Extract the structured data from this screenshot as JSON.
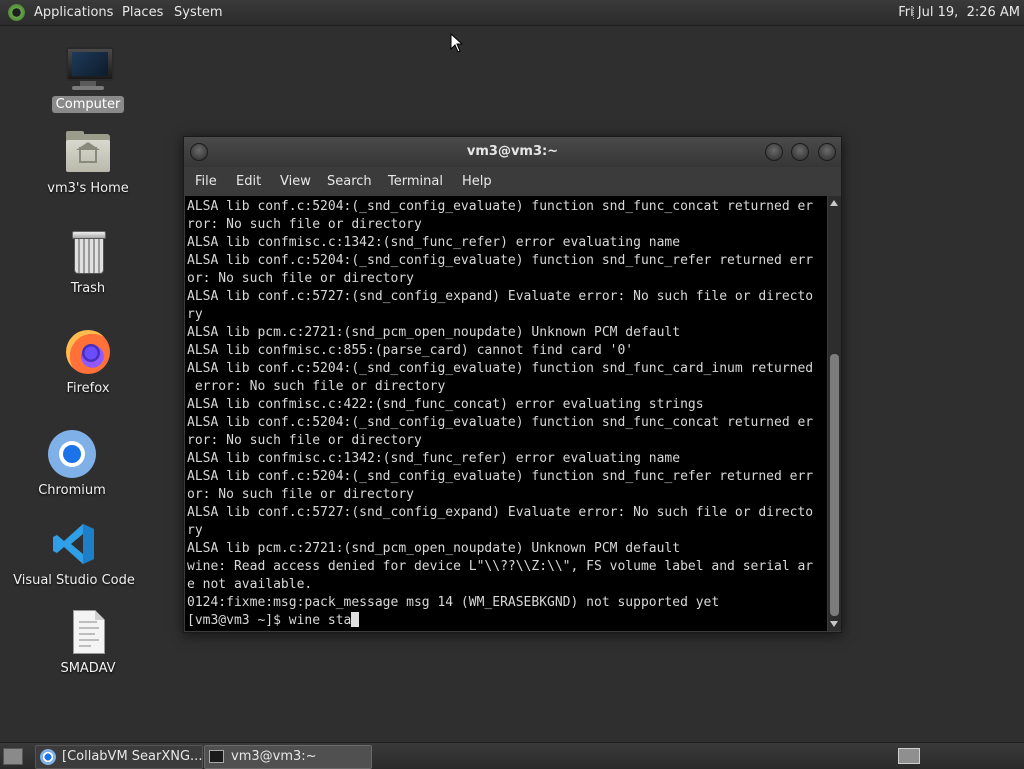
{
  "top_panel": {
    "menus": [
      "Applications",
      "Places",
      "System"
    ],
    "clock": "Fri Jul 19,  2:26 AM"
  },
  "desktop_icons": [
    {
      "label": "Computer",
      "icon": "computer-icon"
    },
    {
      "label": "vm3's Home",
      "icon": "home-folder-icon"
    },
    {
      "label": "Trash",
      "icon": "trash-icon"
    },
    {
      "label": "Firefox",
      "icon": "firefox-icon"
    },
    {
      "label": "Chromium",
      "icon": "chromium-icon"
    },
    {
      "label": "Visual Studio Code",
      "icon": "vscode-icon"
    },
    {
      "label": "SMADAV",
      "icon": "document-icon"
    }
  ],
  "terminal": {
    "title": "vm3@vm3:~",
    "menu": [
      "File",
      "Edit",
      "View",
      "Search",
      "Terminal",
      "Help"
    ],
    "lines": [
      "ALSA lib conf.c:5204:(_snd_config_evaluate) function snd_func_concat returned er",
      "ror: No such file or directory",
      "ALSA lib confmisc.c:1342:(snd_func_refer) error evaluating name",
      "ALSA lib conf.c:5204:(_snd_config_evaluate) function snd_func_refer returned err",
      "or: No such file or directory",
      "ALSA lib conf.c:5727:(snd_config_expand) Evaluate error: No such file or directo",
      "ry",
      "ALSA lib pcm.c:2721:(snd_pcm_open_noupdate) Unknown PCM default",
      "ALSA lib confmisc.c:855:(parse_card) cannot find card '0'",
      "ALSA lib conf.c:5204:(_snd_config_evaluate) function snd_func_card_inum returned",
      " error: No such file or directory",
      "ALSA lib confmisc.c:422:(snd_func_concat) error evaluating strings",
      "ALSA lib conf.c:5204:(_snd_config_evaluate) function snd_func_concat returned er",
      "ror: No such file or directory",
      "ALSA lib confmisc.c:1342:(snd_func_refer) error evaluating name",
      "ALSA lib conf.c:5204:(_snd_config_evaluate) function snd_func_refer returned err",
      "or: No such file or directory",
      "ALSA lib conf.c:5727:(snd_config_expand) Evaluate error: No such file or directo",
      "ry",
      "ALSA lib pcm.c:2721:(snd_pcm_open_noupdate) Unknown PCM default",
      "wine: Read access denied for device L\"\\\\??\\\\Z:\\\\\", FS volume label and serial ar",
      "e not available.",
      "0124:fixme:msg:pack_message msg 14 (WM_ERASEBKGND) not supported yet"
    ],
    "prompt": "[vm3@vm3 ~]$ ",
    "command": "wine sta"
  },
  "taskbar": {
    "tasks": [
      {
        "label": "[CollabVM SearXNG...",
        "icon": "chromium-icon",
        "active": false
      },
      {
        "label": "vm3@vm3:~",
        "icon": "terminal-icon",
        "active": true
      }
    ]
  }
}
